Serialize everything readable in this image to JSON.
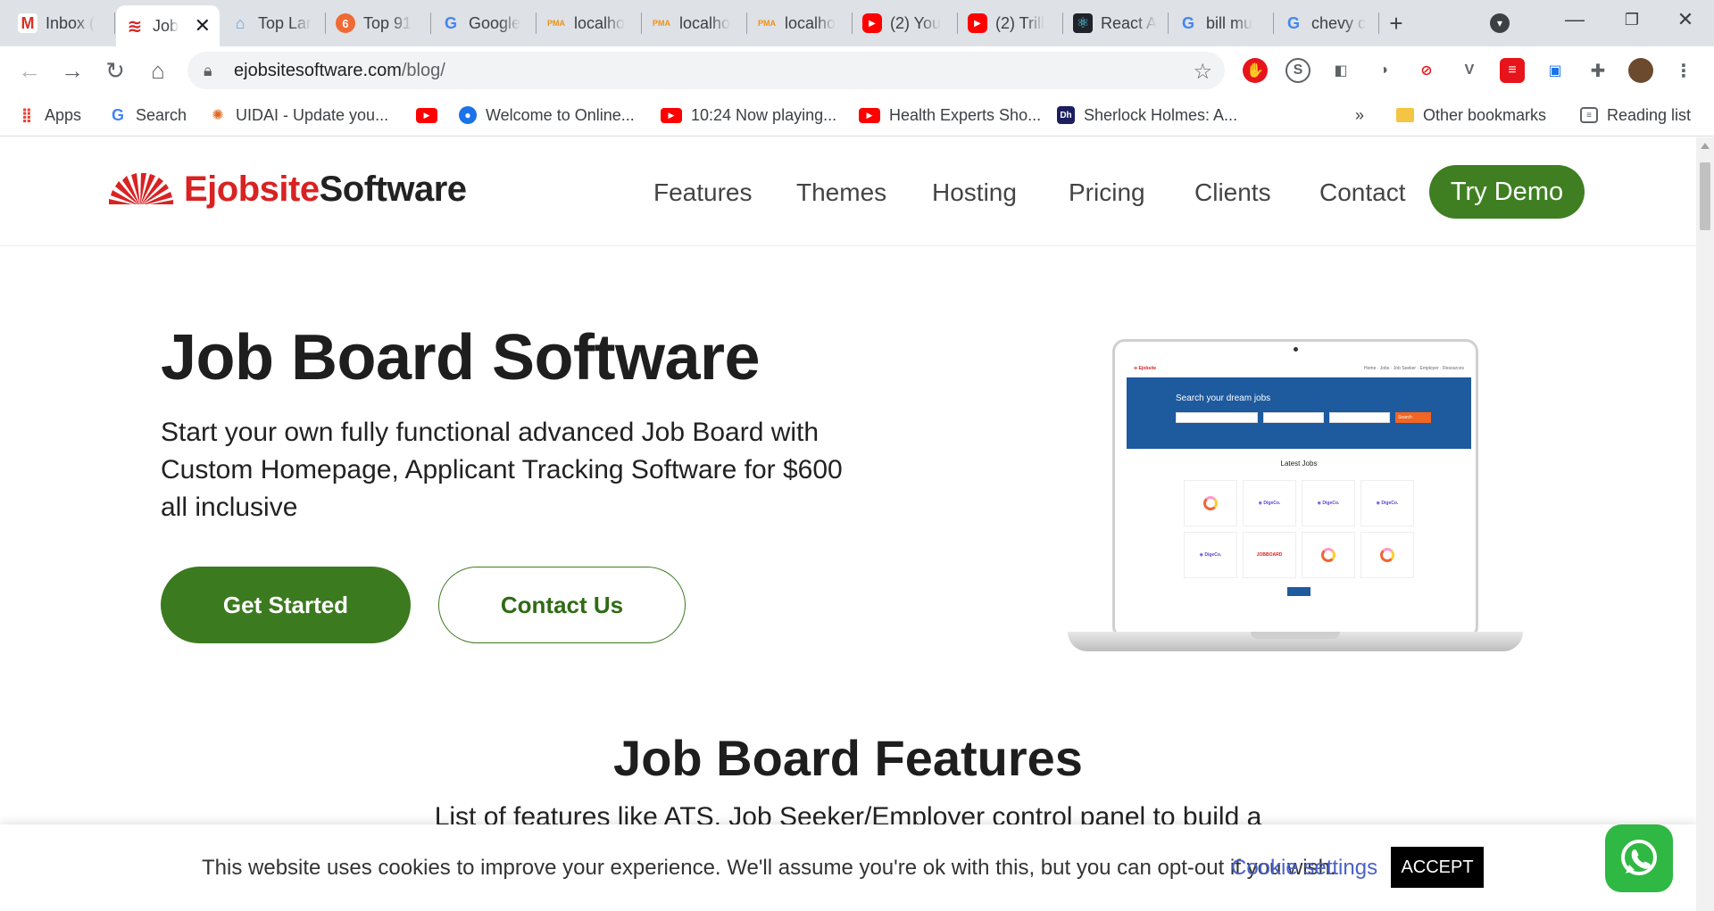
{
  "browser": {
    "tabs": [
      {
        "title": "Inbox (",
        "icon": "gmail-icon",
        "color": "#d93025",
        "glyph": "M"
      },
      {
        "title": "Job",
        "icon": "ejobsite-icon",
        "color": "#d92222",
        "glyph": "≋",
        "active": true
      },
      {
        "title": "Top Lar",
        "icon": "site-icon",
        "color": "#6aa0d8",
        "glyph": "⌂"
      },
      {
        "title": "Top 91",
        "icon": "orange-circle-icon",
        "color": "#f06a35",
        "glyph": "6"
      },
      {
        "title": "Google",
        "icon": "google-icon",
        "color": "#4285f4",
        "glyph": "G"
      },
      {
        "title": "localho",
        "icon": "phpmyadmin-icon",
        "color": "#f29111",
        "glyph": "PMA"
      },
      {
        "title": "localho",
        "icon": "phpmyadmin-icon",
        "color": "#f29111",
        "glyph": "PMA"
      },
      {
        "title": "localho",
        "icon": "phpmyadmin-icon",
        "color": "#f29111",
        "glyph": "PMA"
      },
      {
        "title": "(2) You",
        "icon": "youtube-icon",
        "color": "#ff0000",
        "glyph": "▶"
      },
      {
        "title": "(2) Trill",
        "icon": "youtube-icon",
        "color": "#ff0000",
        "glyph": "▶"
      },
      {
        "title": "React A",
        "icon": "react-icon",
        "color": "#20232a",
        "glyph": "⚛"
      },
      {
        "title": "bill mu",
        "icon": "google-icon",
        "color": "#4285f4",
        "glyph": "G"
      },
      {
        "title": "chevy c",
        "icon": "google-icon",
        "color": "#4285f4",
        "glyph": "G"
      }
    ],
    "new_tab": "+",
    "url_host": "ejobsitesoftware.com",
    "url_path": "/blog/",
    "bookmarks": [
      {
        "label": "Apps",
        "icon": "apps-grid-icon",
        "color": "#4285f4"
      },
      {
        "label": "Search",
        "icon": "google-icon",
        "color": "#4285f4"
      },
      {
        "label": "UIDAI - Update you...",
        "icon": "uidai-icon",
        "color": "#e06a1e"
      },
      {
        "label": "",
        "icon": "youtube-icon",
        "color": "#ff0000"
      },
      {
        "label": "Welcome to Online...",
        "icon": "location-icon",
        "color": "#1a73e8"
      },
      {
        "label": "10:24 Now playing...",
        "icon": "youtube-icon",
        "color": "#ff0000"
      },
      {
        "label": "Health Experts Sho...",
        "icon": "youtube-icon",
        "color": "#ff0000"
      },
      {
        "label": "Sherlock Holmes: A...",
        "icon": "dh-icon",
        "color": "#1b1f5e"
      }
    ],
    "bookmarks_overflow": "»",
    "other_bookmarks": "Other bookmarks",
    "reading_list": "Reading list"
  },
  "site": {
    "brand_part1": "Ejobsite",
    "brand_part2": "Software",
    "nav": [
      "Features",
      "Themes",
      "Hosting",
      "Pricing",
      "Clients",
      "Contact"
    ],
    "try_demo": "Try Demo",
    "hero_title": "Job Board Software",
    "hero_sub": "Start your own fully functional advanced Job Board with Custom Homepage, Applicant Tracking Software for $600 all inclusive",
    "get_started": "Get Started",
    "contact_us": "Contact Us",
    "features_title": "Job Board Features",
    "features_sub": "List of features like ATS, Job Seeker/Employer control panel to build a",
    "mockup": {
      "hero": "Search your dream jobs",
      "search_btn": "Search",
      "latest": "Latest Jobs"
    }
  },
  "cookie": {
    "message": "This website uses cookies to improve your experience. We'll assume you're ok with this, but you can opt-out if you wish.",
    "settings": "Cookie settings",
    "accept": "ACCEPT"
  },
  "colors": {
    "brand_green": "#3b7a1f",
    "brand_red": "#d92222",
    "whatsapp": "#2fb843"
  }
}
